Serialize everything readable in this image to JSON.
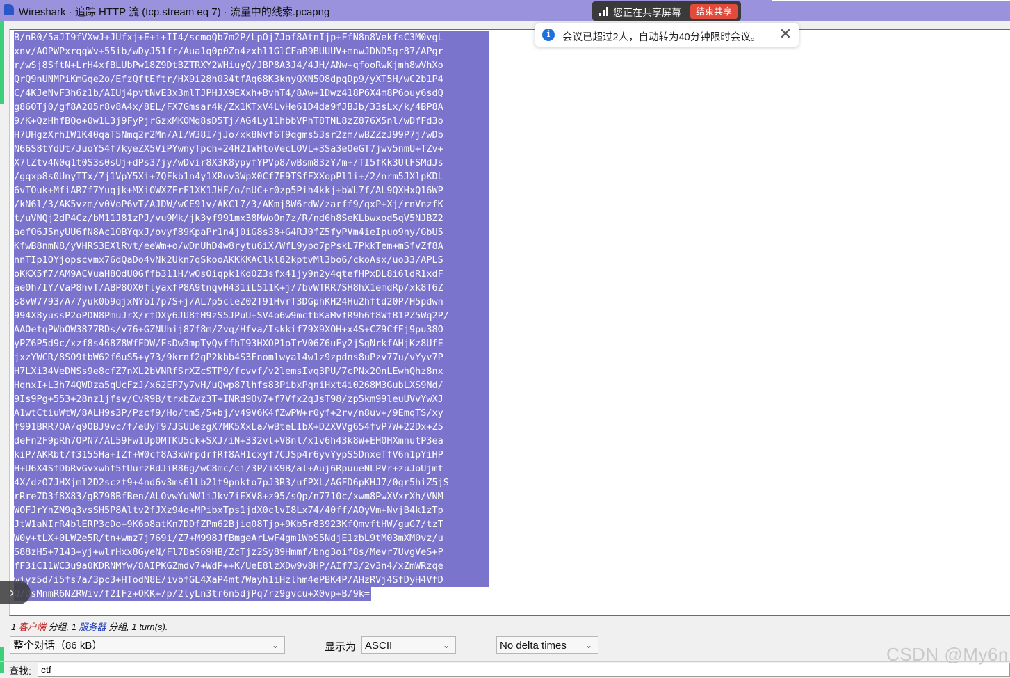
{
  "window": {
    "title": "Wireshark · 追踪 HTTP 流 (tcp.stream eq 7) · 流量中的线索.pcapng"
  },
  "share_bar": {
    "text": "您正在共享屏幕",
    "end_label": "结束共享"
  },
  "toast": {
    "text": "会议已超过2人，自动转为40分钟限时会议。",
    "close": "✕"
  },
  "stream_lines": [
    "B/nR0/5aJI9fVXwJ+JUfxj+E+i+II4/scmoQb7m2P/LpOj7Jof8AtnIjp+FfN8n8VekfsC3M0vgL",
    "xnv/AOPWPxrqqWv+55ib/wDyJ51fr/Aua1q0p0Zn4zxhl1GlCFaB9BUUUV+mnwJDND5gr87/APgr",
    "r/wSj8SftN+LrH4xfBLUbPw18Z9DtBZTRXY2WHiuyQ/JBP8A3J4/4JH/ANw+qfooRwKjmh8wVhXo",
    "QrQ9nUNMPiKmGqe2o/EfzQftEftr/HX9i28h034tfAq68K3knyQXN5O8dpqDp9/yXT5H/wC2b1P4",
    "C/4KJeNvF3h6z1b/AIUj4pvtNvE3x3mlTJPHJX9EXxh+BvhT4/8Aw+1Dwz418P6X4m8P6ouy6sdQ",
    "g86OTj0/gf8A205r8v8A4x/8EL/FX7Gmsar4k/Zx1KTxV4LvHe61D4da9fJBJb/33sLx/k/4BP8A",
    "9/K+QzHhfBQo+0w1L3j9FyPjrGzxMKOMq8sD5Tj/AG4Ly11hbbVPhT8TNL8zZ876X5nl/wDfFd3o",
    "H7UHgzXrhIW1K40qaT5Nmq2r2Mn/AI/W38I/jJo/xk8Nvf6T9qgms53sr2zm/wBZZzJ99P7j/wDb",
    "N66S8tYdUt/JuoY54f7kyeZX5ViPYwnyTpch+24H21WHtoVecLOVL+3Sa3eOeGT7jwv5nmU+TZv+",
    "X7lZtv4N0q1t0S3s0sUj+dPs37jy/wDvir8X3K8ypyfYPVp8/wBsm83zY/m+/TI5fKk3UlFSMdJs",
    "/gqxp8s0UnyTTx/7j1VpY5Xi+7QFkb1n4y1XRov3WpX0Cf7E9TSfFXXopPl1i+/2/nrm5JXlpKDL",
    "6vTOuk+MfiAR7f7Yuqjk+MXiOWXZFrF1XK1JHF/o/nUC+r0zp5Pih4kkj+bWL7f/AL9QXHxQ16WP",
    "/kN6l/3/AK5vzm/v0VoP6vT/AJDW/wCE91v/AKCl7/3/AKmj8W6rdW/zarff9/qxP+Xj/rnVnzfK",
    "t/uVNQj2dP4Cz/bM11J81zPJ/vu9Mk/jk3yf991mx38MWoOn7z/R/nd6h8SeKLbwxod5qV5NJBZ2",
    "aefO6J5nyUU6fN8Ac1OBYqxJ/ovyf89KpaPr1n4j0iG8s38+G4RJ0fZ5fyPVm4ieIpuo9ny/GbU5",
    "KfwB8nmN8/yVHRS3EXlRvt/eeWm+o/wDnUhD4w8rytu6iX/WfL9ypo7pPskL7PkkTem+mSfvZf8A",
    "nnTIp1OYjopscvmx76dQaDo4vNk2Ukn7qSkooAKKKKAClkl82kptvMl3bo6/ckoAsx/uo33/APLS",
    "oKKX5f7/AM9ACVuaH8QdU0Gffb311H/wOsOiqpk1KdOZ3sfx41jy9n2y4qtefHPxDL8i6ldR1xdF",
    "ae0h/IY/VaP8hvT/ABP8QX0flyaxfP8A9tnqvH431iL511K+j/7bvWTRR7SH8hX1emdRp/xk8T6Z",
    "s8vW7793/A/7yuk0b9qjxNYbI7p7S+j/AL7p5cleZ02T91HvrT3DGphKH24Hu2hftd20P/H5pdwn",
    "994X8yussP2oPDN8PmuJrX/rtDXy6JU8tH9zS5JPuU+SV4o6w9mctbKaMvfR9h6f8WtB1PZ5Wq2P/",
    "AAOetqPWbOW3877RDs/v76+GZNUhij87f8m/Zvq/Hfva/Iskkif79X9XOH+x4S+CZ9CfFj9pu38O",
    "yPZ6P5d9c/xzf8s468Z8WfFDW/FsDw3mpTyQyffhT93HXOP1oTrV06Z6uFy2jSgNrkfAHjKz8UfE",
    "jxzYWCR/8SO9tbW62f6uS5+y73/9krnf2gP2kbb4S3Fnomlwyal4w1z9zpdns8uPzv77u/vYyv7P",
    "H7LXi34VeDNSs9e8cfZ7nXL2bVNRfSrXZcSTP9/fcvvf/v2lemsIvq3PU/7cPNx2OnLEwhQhz8nx",
    "HqnxI+L3h74QWDza5qUcFzJ/x62EP7y7vH/uQwp87lhfs83PibxPqniHxt4i0268M3GubLXS9Nd/",
    "9Is9Pg+553+28nz1jfsv/CvR9B/trxbZwz3T+INRd9Ov7+f7Vfx2qJsT98/zp5km99leuUVvYwXJ",
    "A1wtCtiuWtW/8ALH9s3P/Pzcf9/Ho/tm5/5+bj/v49V6K4fZwPW+r0yf+2rv/n8uv+/9EmqTS/xy",
    "f991BRR7OA/q9OBJ9vc/f/eUyT97JSUUezgX7MK5XxLa/wBteLIbX+DZXVVg654fvP7W+22Dx+Z5",
    "deFn2F9pRh7OPN7/AL59Fw1Up0MTKU5ck+SXJ/iN+332vl+V8nl/x1v6h43k8W+EH0HXmnutP3ea",
    "kiP/AKRbt/f3155Ha+IZf+W0cf8A3xWrpdrfRf8AH1cxyf7CJSp4r6yvYypS5DnxeTfV6n1pYiHP",
    "H+U6X4SfDbRvGvxwht5tUurzRdJiR86g/wC8mc/ci/3P/iK9B/al+Auj6RpuueNLPVr+zuJoUjmt",
    "4X/dzO7JHXjml2D2sczt9+4nd6v3ms6lLb21t9pnkto7pJ3R3/ufPXL/AGFD6pKHJ7/0gr5hiZ5jS",
    "rRre7D3f8X83/gR798BfBen/ALOvwYuNW1iJkv7iEXV8+z95/sQp/n7710c/xwm8PwXVxrXh/VNM",
    "WOFJrYnZN9q3vsSH5P8Altv2fJXz94o+MPibxTps1jdX0clvI8Lx74/40ff/AOyVm+NvjB4k1zTp",
    "JtW1aNIrR4blERP3cDo+9K6o8atKn7DDfZPm62Bjiq08Tjp+9Kb5r83923KfQmvftHW/guG7/tzT",
    "W0y+tLX+0LW2e5R/tn+wmz7j769i/Z7+M998JfBmgeArLwF4gm1WbS5NdjE1zbL9tM03mXM0vz/u",
    "S88zH5+7143+yj+wlrHxx8GyeN/Fl7DaS69HB/ZcTjz2Sy89Hmmf/bng3oif8s/Mevr7UvgVeS+P",
    "fF3iC11WC3u9a0KDRNMYw/8AIPKGZmdv7+WdP++K/UeE8lzXDw9v8HP/AIf73/2v3n4/xZmWRzqe",
    "wiyz5d/i5fs7a/3pc3+HTodN8E/ivbfGL4XaP4mt7Wayh1iHzlhm4ePBK4P/AHzRVj4SfDyH4VfD",
    "Q/DsMnmR6NZRWiv/f2IFz+OKK+/p/2lyLn3tr6n5djPq7rz9gvcu+X0vp+B/9k="
  ],
  "summary": {
    "prefix": "1 ",
    "client": "客户端",
    "mid": " 分组, 1 ",
    "server": "服务器",
    "suffix": " 分组, 1 turn(s)."
  },
  "controls": {
    "conversation": "整个对话（86 kB）",
    "show_as_label": "显示为",
    "show_as": "ASCII",
    "delta": "No delta times"
  },
  "find": {
    "label": "查找:",
    "value": "ctf"
  },
  "watermark": "CSDN @My6n",
  "colors": {
    "selection": "#7b74cc",
    "titlebar": "#9a92dc",
    "end_share": "#e24b3b",
    "client": "#c41818",
    "server": "#1a38b8"
  }
}
